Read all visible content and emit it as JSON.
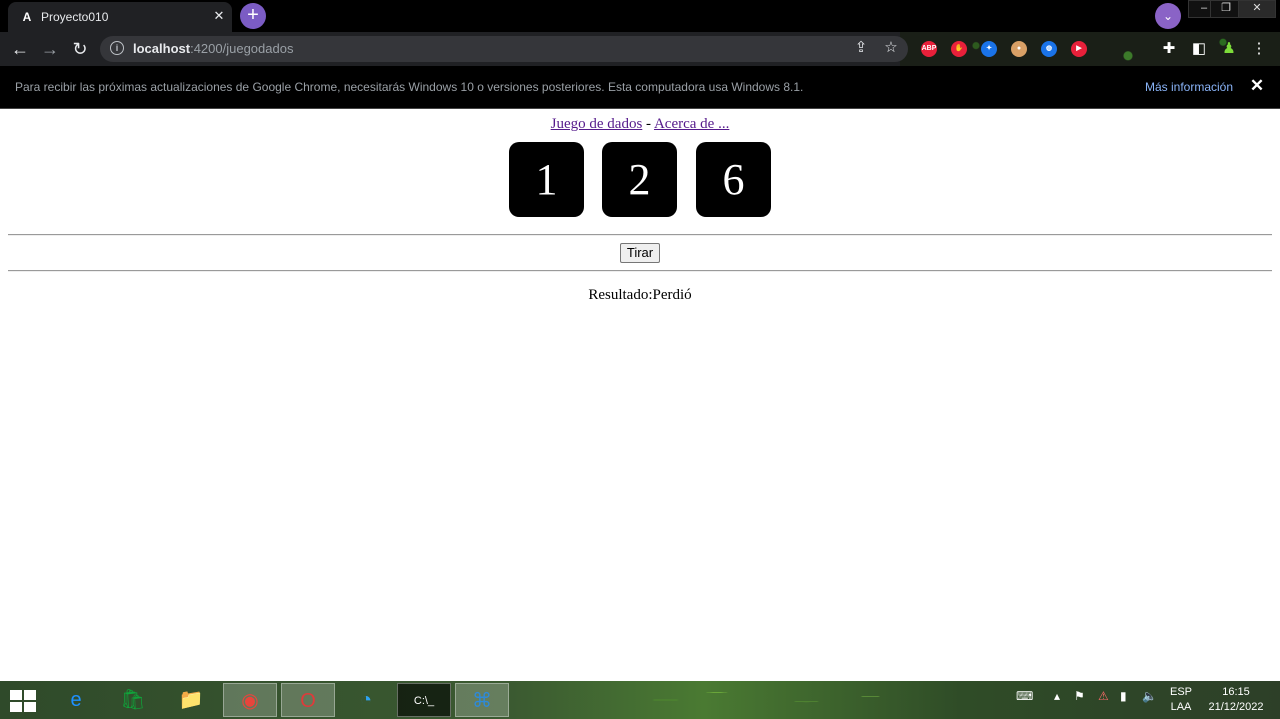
{
  "browser": {
    "tab": {
      "favicon": "A",
      "title": "Proyecto010",
      "close": "✕"
    },
    "new_tab": "+",
    "window_controls": {
      "minimize": "–",
      "restore": "❐",
      "close": "✕"
    },
    "url": {
      "host": "localhost",
      "path": ":4200/juegodados"
    },
    "extensions": [
      {
        "name": "adblock-plus-icon",
        "label": "ABP",
        "color": "#e8203a"
      },
      {
        "name": "hand-icon",
        "label": "✋",
        "color": "#e8203a"
      },
      {
        "name": "gamepad-icon",
        "label": "✦",
        "color": "#1a73e8"
      },
      {
        "name": "cookie-icon",
        "label": "●",
        "color": "#d9a066"
      },
      {
        "name": "globe-icon",
        "label": "◍",
        "color": "#1a73e8"
      },
      {
        "name": "video-icon",
        "label": "▶",
        "color": "#e8203a"
      }
    ],
    "infobar": {
      "message": "Para recibir las próximas actualizaciones de Google Chrome, necesitarás Windows 10 o versiones posteriores. Esta computadora usa Windows 8.1.",
      "link": "Más información",
      "close": "✕"
    }
  },
  "page": {
    "nav": {
      "link1": "Juego de dados",
      "separator": " - ",
      "link2": "Acerca de ..."
    },
    "dice": [
      "1",
      "2",
      "6"
    ],
    "throw_button": "Tirar",
    "result": "Resultado:Perdió"
  },
  "taskbar": {
    "apps": [
      {
        "name": "internet-explorer-icon",
        "glyph": "e",
        "color": "#1e90ff"
      },
      {
        "name": "store-icon",
        "glyph": "🛍",
        "color": "#10a33a"
      },
      {
        "name": "file-explorer-icon",
        "glyph": "📁",
        "color": "#f2c94c"
      },
      {
        "name": "chrome-icon",
        "glyph": "◉",
        "color": "#e8453c"
      },
      {
        "name": "opera-icon",
        "glyph": "O",
        "color": "#e03a3a"
      },
      {
        "name": "browser-icon",
        "glyph": "◔",
        "color": "#2ea3f2"
      },
      {
        "name": "terminal-icon",
        "glyph": "C:\\_",
        "color": "#000000"
      },
      {
        "name": "vscode-icon",
        "glyph": "⌘",
        "color": "#2f8ad8"
      }
    ],
    "lang_top": "ESP",
    "lang_bottom": "LAA",
    "time": "16:15",
    "date": "21/12/2022"
  }
}
